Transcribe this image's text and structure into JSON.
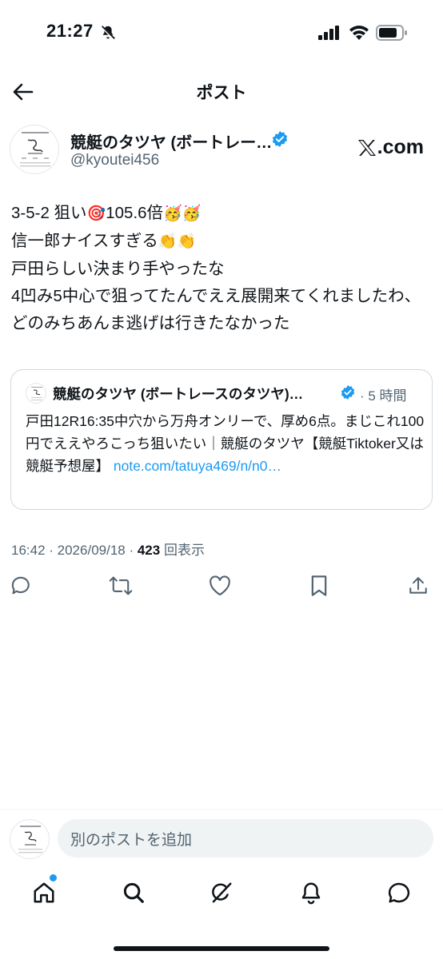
{
  "status_bar": {
    "time": "21:27"
  },
  "nav": {
    "title": "ポスト"
  },
  "author": {
    "name": "競艇のタツヤ (ボートレー…",
    "handle": "@kyoutei456",
    "source_badge": ".com"
  },
  "post": {
    "lines": [
      {
        "text": "3-5-2 狙い",
        "emoji_after": "🎯",
        "text2": "105.6倍",
        "emoji_end": "🥳🥳"
      },
      {
        "text": "信一郎ナイスすぎる",
        "emoji_end": "👏👏"
      },
      {
        "text": "戸田らしい決まり手やったな"
      },
      {
        "text": "4凹み5中心で狙ってたんでええ展開来てくれましたわ、どのみちあんま逃げは行きたなかった"
      }
    ]
  },
  "quote": {
    "name": "競艇のタツヤ (ボートレースのタツヤ)…",
    "time": "· 5 時間",
    "text": "戸田12R16:35中穴から万舟オンリーで、厚め6点。まじこれ100円でええやろこっち狙いたい｜競艇のタツヤ【競艇Tiktoker又は競艇予想屋】",
    "link": "note.com/tatuya469/n/n0…"
  },
  "meta": {
    "time": "16:42 · 2026/09/18 · ",
    "views": "423",
    "views_label": " 回表示"
  },
  "reply": {
    "placeholder": "別のポストを追加"
  },
  "icons": [
    "back-arrow-icon",
    "verified-icon",
    "x-logo-icon",
    "reply-icon",
    "repost-icon",
    "like-icon",
    "bookmark-icon",
    "share-icon",
    "home-icon",
    "search-icon",
    "grok-icon",
    "bell-icon",
    "messages-icon"
  ],
  "colors": {
    "accent": "#1d9bf0",
    "text": "#0f1419",
    "secondary": "#536471",
    "border": "#cfd9de"
  }
}
